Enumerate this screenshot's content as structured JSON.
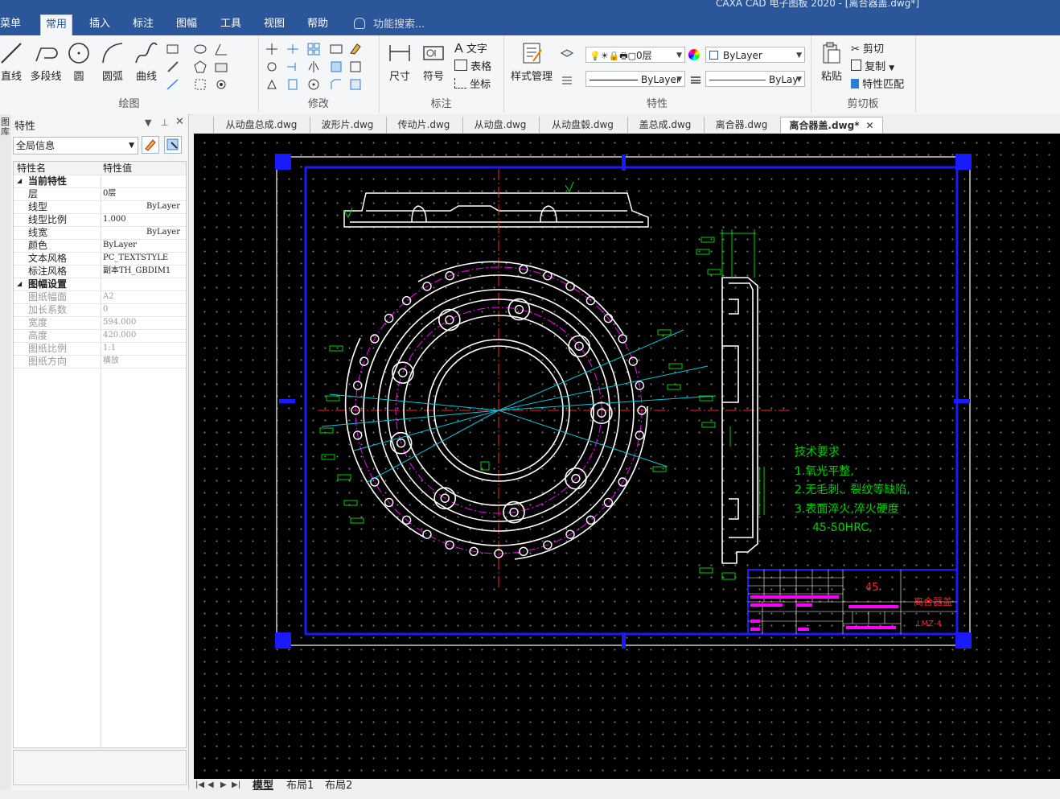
{
  "window": {
    "title": "CAXA CAD 电子图板 2020 - [离合器盖.dwg*]"
  },
  "menu": {
    "tabs": [
      "菜单",
      "常用",
      "插入",
      "标注",
      "图幅",
      "工具",
      "视图",
      "帮助"
    ],
    "active": "常用",
    "search_placeholder": "功能搜索..."
  },
  "ribbon": {
    "draw": {
      "label": "绘图",
      "line": "直线",
      "polyline": "多段线",
      "circle": "圆",
      "arc": "圆弧",
      "curve": "曲线"
    },
    "modify": {
      "label": "修改"
    },
    "annotate": {
      "label": "标注",
      "dimension": "尺寸",
      "symbol": "符号",
      "text": "文字",
      "table": "表格",
      "coordinate": "坐标"
    },
    "properties": {
      "label": "特性",
      "style_manager": "样式管理",
      "layer": "0层",
      "color": "ByLayer",
      "linetype": "ByLayer",
      "lineweight": "ByLay"
    },
    "clipboard": {
      "label": "剪切板",
      "paste": "粘贴",
      "cut": "剪切",
      "copy": "复制",
      "match": "特性匹配"
    }
  },
  "doc_tabs": [
    "从动盘总成.dwg",
    "波形片.dwg",
    "传动片.dwg",
    "从动盘.dwg",
    "从动盘毂.dwg",
    "盖总成.dwg",
    "离合器.dwg",
    "离合器盖.dwg*"
  ],
  "side_strip": {
    "label": "图库"
  },
  "props": {
    "title": "特性",
    "selector": "全局信息",
    "col_name": "特性名",
    "col_value": "特性值",
    "current": {
      "label": "当前特性",
      "rows": [
        {
          "name": "层",
          "value": "0层"
        },
        {
          "name": "线型",
          "value": "ByLayer"
        },
        {
          "name": "线型比例",
          "value": "1.000"
        },
        {
          "name": "线宽",
          "value": "ByLayer"
        },
        {
          "name": "颜色",
          "value": "ByLayer"
        },
        {
          "name": "文本风格",
          "value": "PC_TEXTSTYLE"
        },
        {
          "name": "标注风格",
          "value": "副本TH_GBDIM1"
        }
      ]
    },
    "sheet": {
      "label": "图幅设置",
      "rows": [
        {
          "name": "图纸幅面",
          "value": "A2"
        },
        {
          "name": "加长系数",
          "value": "0"
        },
        {
          "name": "宽度",
          "value": "594.000"
        },
        {
          "name": "高度",
          "value": "420.000"
        },
        {
          "name": "图纸比例",
          "value": "1:1"
        },
        {
          "name": "图纸方向",
          "value": "横放"
        }
      ]
    }
  },
  "drawing": {
    "tech_req": [
      "技术要求",
      "1.氧光平整,",
      "2.无毛刺、裂纹等缺陷,",
      "3.表面淬火,淬火硬度",
      "45-50HRC,"
    ],
    "title_block": {
      "material": "45",
      "part_name": "离合器盖",
      "code": "LMZ-4"
    }
  },
  "layout_tabs": [
    "模型",
    "布局1",
    "布局2"
  ],
  "colors": {
    "accent": "#2b579a",
    "canvas": "#000000",
    "frame": "#0000ff",
    "green": "#00d000",
    "cyan": "#00c8d8",
    "magenta": "#ff00ff",
    "red": "#ff2020"
  }
}
